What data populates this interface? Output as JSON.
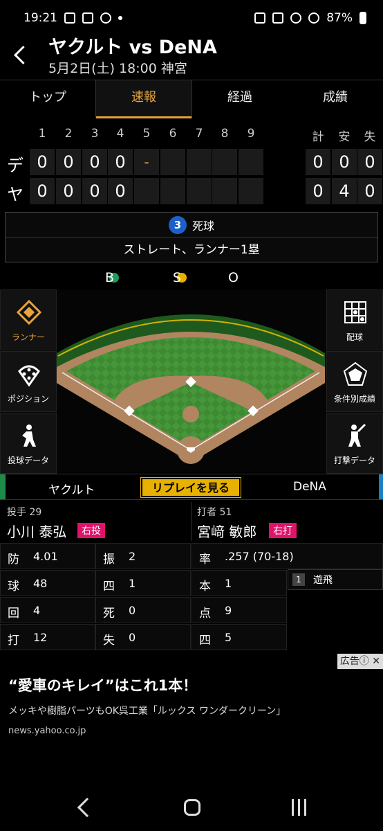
{
  "status_bar": {
    "time": "19:21",
    "battery": "87%"
  },
  "header": {
    "title": "ヤクルト vs DeNA",
    "subtitle": "5月2日(土) 18:00 神宮"
  },
  "tabs": [
    {
      "label": "トップ",
      "active": false
    },
    {
      "label": "速報",
      "active": true
    },
    {
      "label": "経過",
      "active": false
    },
    {
      "label": "成績",
      "active": false
    }
  ],
  "scoreboard": {
    "innings": [
      "1",
      "2",
      "3",
      "4",
      "5",
      "6",
      "7",
      "8",
      "9"
    ],
    "totals_headers": [
      "計",
      "安",
      "失"
    ],
    "teams": [
      {
        "label": "デ",
        "scores": [
          "0",
          "0",
          "0",
          "0",
          "-",
          "",
          "",
          "",
          ""
        ],
        "totals": [
          "0",
          "0",
          "0"
        ]
      },
      {
        "label": "ヤ",
        "scores": [
          "0",
          "0",
          "0",
          "0",
          "",
          "",
          "",
          "",
          ""
        ],
        "totals": [
          "0",
          "4",
          "0"
        ]
      }
    ]
  },
  "play": {
    "number": "3",
    "result": "死球",
    "detail": "ストレート、ランナー1塁"
  },
  "count": {
    "b_label": "B",
    "s_label": "S",
    "o_label": "O",
    "balls": 1,
    "strikes": 1,
    "outs": 0,
    "ball_color": "#1e9e5a",
    "strike_color": "#e8b100"
  },
  "side_left": [
    {
      "label": "ランナー",
      "icon": "runner-diamond-icon",
      "active": true
    },
    {
      "label": "ポジション",
      "icon": "position-icon",
      "active": false
    },
    {
      "label": "投球データ",
      "icon": "pitcher-icon",
      "active": false
    }
  ],
  "side_right": [
    {
      "label": "配球",
      "icon": "pitch-grid-icon"
    },
    {
      "label": "条件別成績",
      "icon": "radar-chart-icon"
    },
    {
      "label": "打撃データ",
      "icon": "batter-icon"
    }
  ],
  "teams_row": {
    "left": "ヤクルト",
    "replay": "リプレイを見る",
    "right": "DeNA"
  },
  "pitcher": {
    "role": "投手 29",
    "name": "小川 泰弘",
    "tag": "右投"
  },
  "batter": {
    "role": "打者 51",
    "name": "宮﨑 敏郎",
    "tag": "右打"
  },
  "pitcher_stats": [
    {
      "k": "防",
      "v": "4.01"
    },
    {
      "k": "振",
      "v": "2"
    },
    {
      "k": "球",
      "v": "48"
    },
    {
      "k": "四",
      "v": "1"
    },
    {
      "k": "回",
      "v": "4"
    },
    {
      "k": "死",
      "v": "0"
    },
    {
      "k": "打",
      "v": "12"
    },
    {
      "k": "失",
      "v": "0"
    }
  ],
  "batter_stats": [
    {
      "k": "率",
      "v": ".257 (70-18)"
    },
    {
      "k": "本",
      "v": "1"
    },
    {
      "k": "点",
      "v": "9"
    },
    {
      "k": "四",
      "v": "5"
    }
  ],
  "at_bat_history": [
    {
      "n": "1",
      "t": "遊飛"
    }
  ],
  "ad": {
    "badge": "広告ⓘ ✕",
    "title": "“愛車のキレイ”はこれ1本！",
    "desc": "メッキや樹脂パーツもOK呉工業「ルックス ワンダークリーン」",
    "url": "news.yahoo.co.jp"
  }
}
